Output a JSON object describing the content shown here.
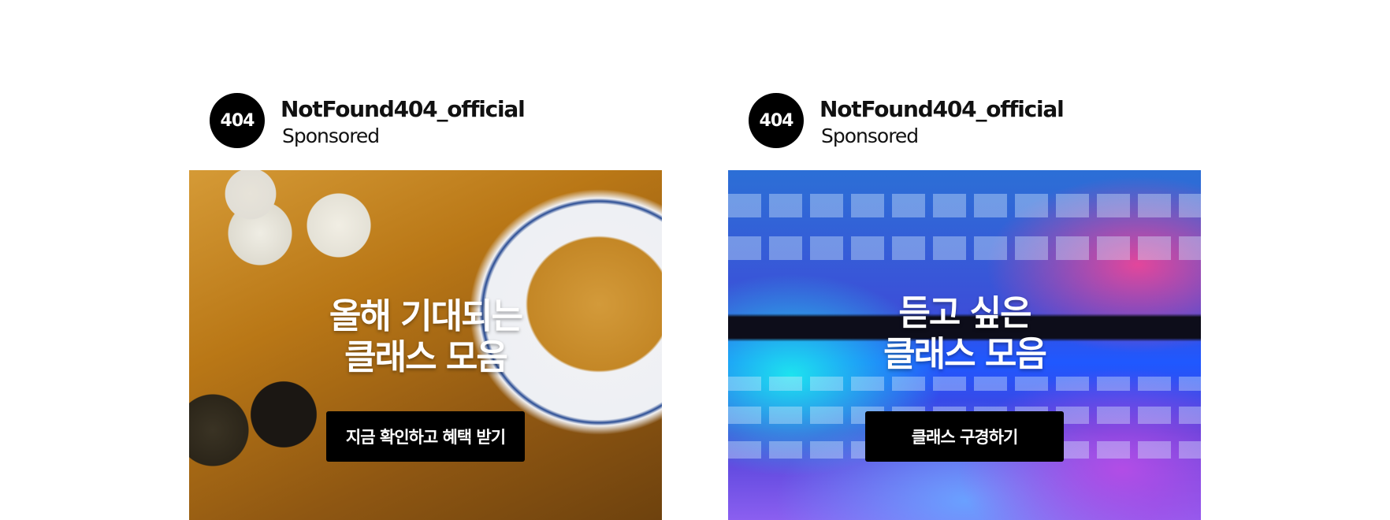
{
  "ads": [
    {
      "account_name": "NotFound404_official",
      "avatar_text": "404",
      "label": "Sponsored",
      "headline_line1": "올해 기대되는",
      "headline_line2": "클래스 모음",
      "cta_label": "지금 확인하고 혜택 받기"
    },
    {
      "account_name": "NotFound404_official",
      "avatar_text": "404",
      "label": "Sponsored",
      "headline_line1": "듣고 싶은",
      "headline_line2": "클래스 모음",
      "cta_label": "클래스 구경하기"
    }
  ]
}
